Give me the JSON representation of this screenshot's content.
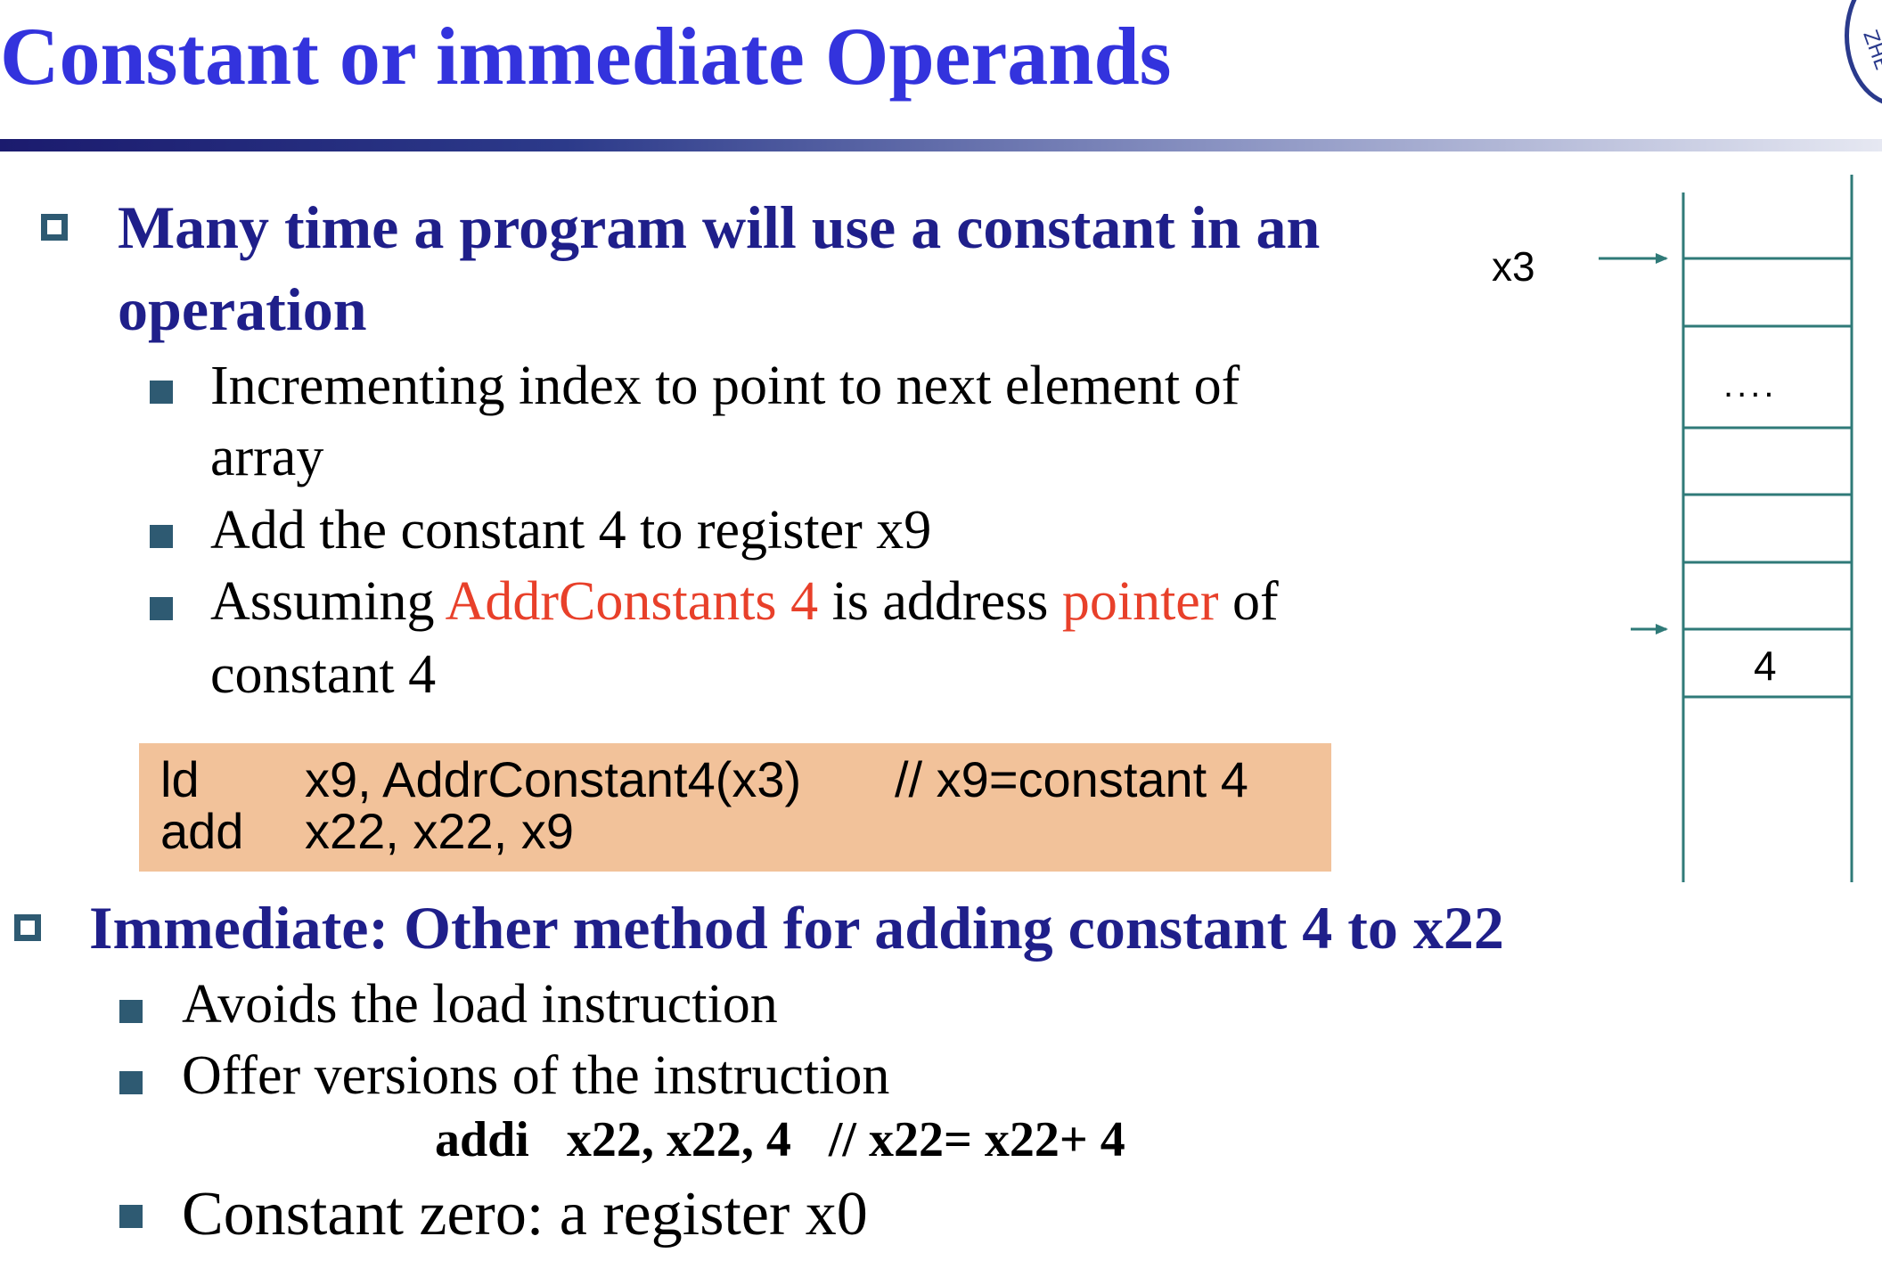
{
  "slide": {
    "title": "Constant or immediate Operands",
    "logo_text": "ZHE"
  },
  "bullets": {
    "b1_line1": "Many time a program will use a constant in an",
    "b1_line2": "operation",
    "b1_sub1_line1": "Incrementing index to point to next element of",
    "b1_sub1_line2": "array",
    "b1_sub2": "Add the constant 4 to register x9",
    "b1_sub3_part1": "Assuming ",
    "b1_sub3_red1": "AddrConstants 4",
    "b1_sub3_part2": " is address ",
    "b1_sub3_red2": "pointer",
    "b1_sub3_part3": " of",
    "b1_sub3_line2": "constant 4",
    "b2": "Immediate: Other method for adding constant 4 to x22",
    "b2_sub1": "Avoids the load instruction",
    "b2_sub2": "Offer versions of the instruction",
    "addi_line": "addi   x22, x22, 4   // x22= x22+ 4",
    "b2_sub3": "Constant zero: a register x0"
  },
  "code": {
    "line1_op": "ld",
    "line1_args": "x9, AddrConstant4(x3)",
    "line1_comment": "// x9=constant 4",
    "line2_op": "add",
    "line2_args": "x22, x22, x9"
  },
  "memory_diagram": {
    "pointer_label": "x3",
    "ellipsis": "....",
    "value_cell": "4",
    "colors": {
      "line": "#2f7a78"
    }
  },
  "colors": {
    "title": "#3333dd",
    "heading": "#1f1f8a",
    "highlight": "#e8402a",
    "bullet": "#2e5a72",
    "code_bg": "#f2c29a"
  }
}
